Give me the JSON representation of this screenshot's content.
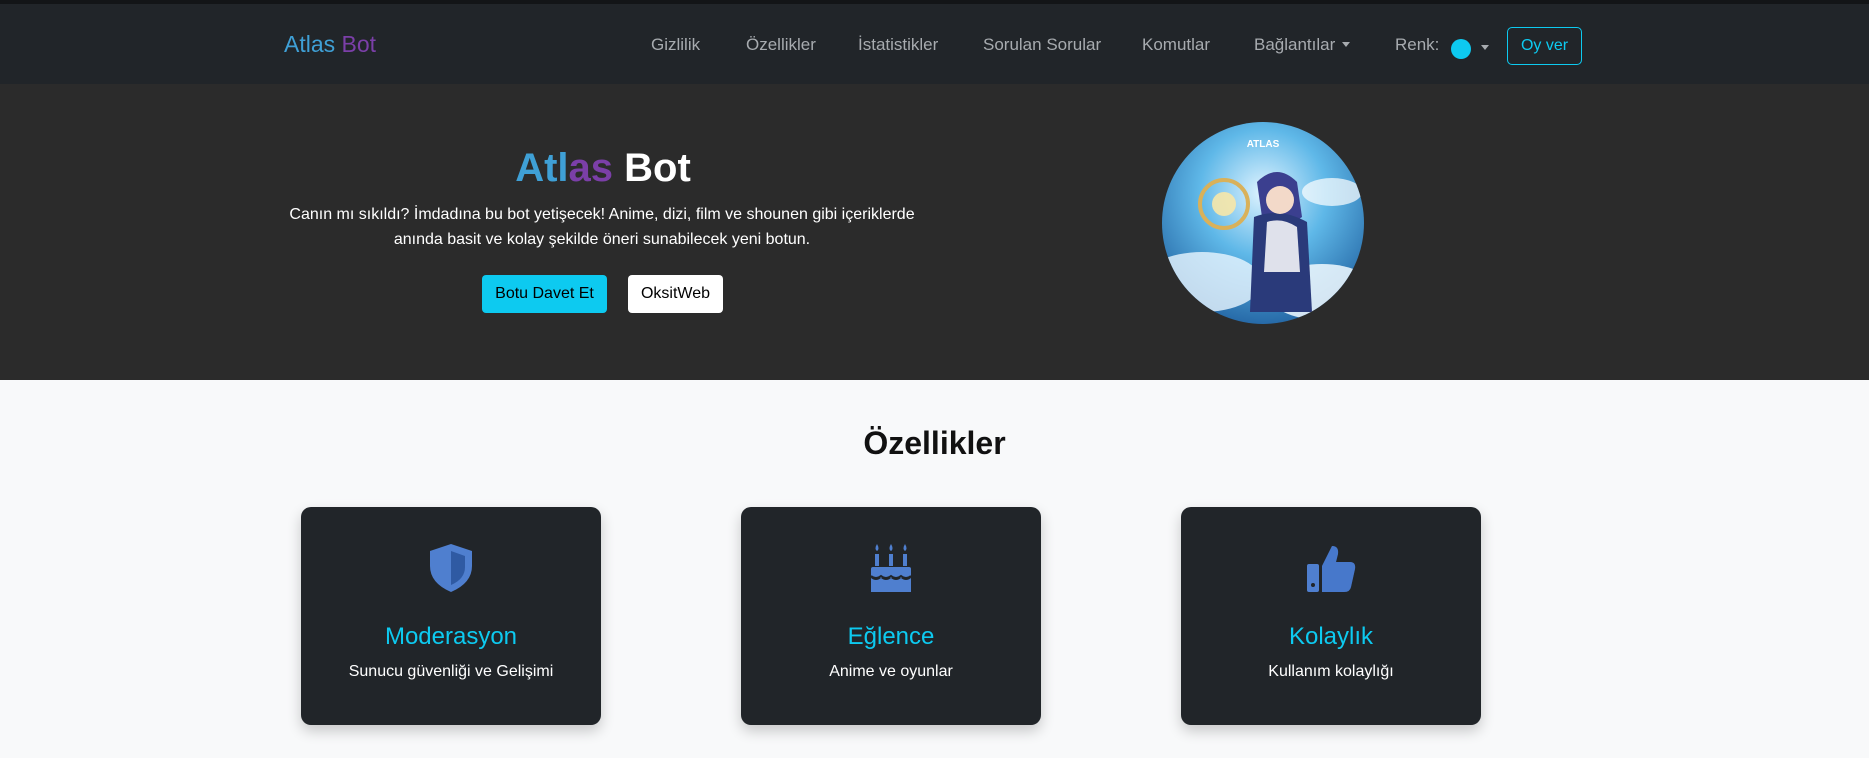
{
  "header": {
    "brand": {
      "part1": "Atlas",
      "part2": "Bot"
    },
    "nav": [
      {
        "label": "Gizlilik"
      },
      {
        "label": "Özellikler"
      },
      {
        "label": "İstatistikler"
      },
      {
        "label": "Sorulan Sorular"
      },
      {
        "label": "Komutlar"
      },
      {
        "label": "Bağlantılar"
      }
    ],
    "color_label": "Renk:",
    "selected_color": "#0dcaf0",
    "vote_button": "Oy ver"
  },
  "hero": {
    "title_part1": "Atlas",
    "title_part2": "Bot",
    "description": "Canın mı sıkıldı? İmdadına bu bot yetişecek! Anime, dizi, film ve shounen gibi içeriklerde anında basit ve kolay şekilde öneri sunabilecek yeni botun.",
    "invite_button": "Botu Davet Et",
    "web_button": "OksitWeb",
    "avatar_logo_text": "ATLAS"
  },
  "features": {
    "title": "Özellikler",
    "cards": [
      {
        "icon": "shield-icon",
        "title": "Moderasyon",
        "text": "Sunucu güvenliği ve Gelişimi"
      },
      {
        "icon": "cake-icon",
        "title": "Eğlence",
        "text": "Anime ve oyunlar"
      },
      {
        "icon": "thumbs-up-icon",
        "title": "Kolaylık",
        "text": "Kullanım kolaylığı"
      }
    ]
  },
  "colors": {
    "accent": "#0dcaf0",
    "brand_blue": "#3fa0d6",
    "brand_purple": "#7b3fa8",
    "icon_blue": "#4f7fcf",
    "navbar_bg": "#212529",
    "hero_bg": "#2b2b2b"
  }
}
